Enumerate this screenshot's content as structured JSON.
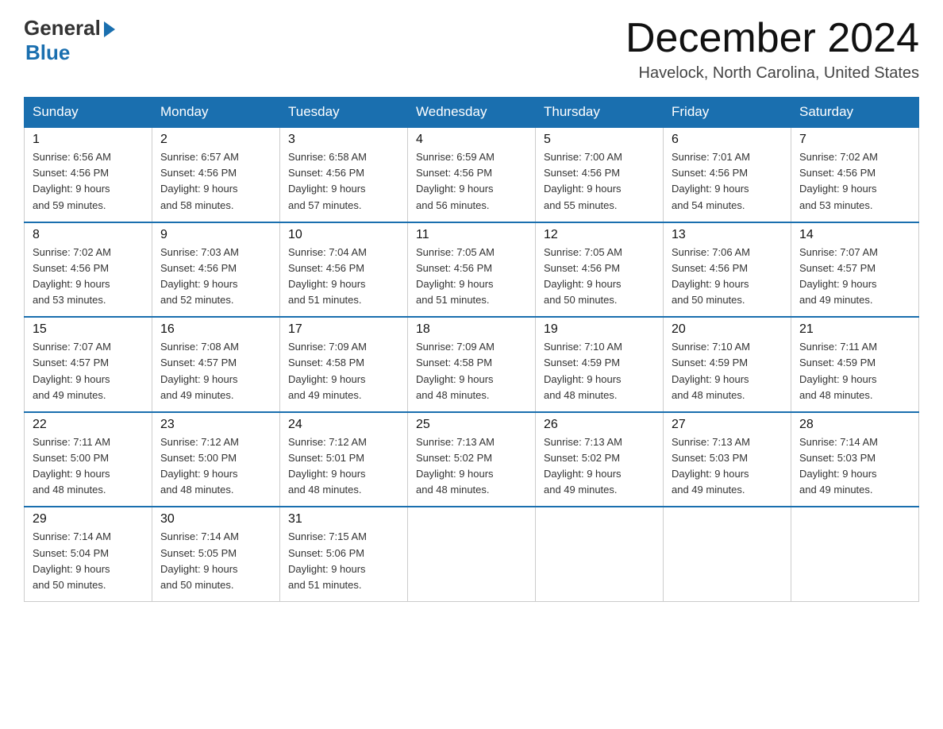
{
  "header": {
    "logo_general": "General",
    "logo_blue": "Blue",
    "logo_subtitle": "Blue",
    "month_title": "December 2024",
    "location": "Havelock, North Carolina, United States"
  },
  "days_of_week": [
    "Sunday",
    "Monday",
    "Tuesday",
    "Wednesday",
    "Thursday",
    "Friday",
    "Saturday"
  ],
  "weeks": [
    [
      {
        "day": "1",
        "info": "Sunrise: 6:56 AM\nSunset: 4:56 PM\nDaylight: 9 hours\nand 59 minutes."
      },
      {
        "day": "2",
        "info": "Sunrise: 6:57 AM\nSunset: 4:56 PM\nDaylight: 9 hours\nand 58 minutes."
      },
      {
        "day": "3",
        "info": "Sunrise: 6:58 AM\nSunset: 4:56 PM\nDaylight: 9 hours\nand 57 minutes."
      },
      {
        "day": "4",
        "info": "Sunrise: 6:59 AM\nSunset: 4:56 PM\nDaylight: 9 hours\nand 56 minutes."
      },
      {
        "day": "5",
        "info": "Sunrise: 7:00 AM\nSunset: 4:56 PM\nDaylight: 9 hours\nand 55 minutes."
      },
      {
        "day": "6",
        "info": "Sunrise: 7:01 AM\nSunset: 4:56 PM\nDaylight: 9 hours\nand 54 minutes."
      },
      {
        "day": "7",
        "info": "Sunrise: 7:02 AM\nSunset: 4:56 PM\nDaylight: 9 hours\nand 53 minutes."
      }
    ],
    [
      {
        "day": "8",
        "info": "Sunrise: 7:02 AM\nSunset: 4:56 PM\nDaylight: 9 hours\nand 53 minutes."
      },
      {
        "day": "9",
        "info": "Sunrise: 7:03 AM\nSunset: 4:56 PM\nDaylight: 9 hours\nand 52 minutes."
      },
      {
        "day": "10",
        "info": "Sunrise: 7:04 AM\nSunset: 4:56 PM\nDaylight: 9 hours\nand 51 minutes."
      },
      {
        "day": "11",
        "info": "Sunrise: 7:05 AM\nSunset: 4:56 PM\nDaylight: 9 hours\nand 51 minutes."
      },
      {
        "day": "12",
        "info": "Sunrise: 7:05 AM\nSunset: 4:56 PM\nDaylight: 9 hours\nand 50 minutes."
      },
      {
        "day": "13",
        "info": "Sunrise: 7:06 AM\nSunset: 4:56 PM\nDaylight: 9 hours\nand 50 minutes."
      },
      {
        "day": "14",
        "info": "Sunrise: 7:07 AM\nSunset: 4:57 PM\nDaylight: 9 hours\nand 49 minutes."
      }
    ],
    [
      {
        "day": "15",
        "info": "Sunrise: 7:07 AM\nSunset: 4:57 PM\nDaylight: 9 hours\nand 49 minutes."
      },
      {
        "day": "16",
        "info": "Sunrise: 7:08 AM\nSunset: 4:57 PM\nDaylight: 9 hours\nand 49 minutes."
      },
      {
        "day": "17",
        "info": "Sunrise: 7:09 AM\nSunset: 4:58 PM\nDaylight: 9 hours\nand 49 minutes."
      },
      {
        "day": "18",
        "info": "Sunrise: 7:09 AM\nSunset: 4:58 PM\nDaylight: 9 hours\nand 48 minutes."
      },
      {
        "day": "19",
        "info": "Sunrise: 7:10 AM\nSunset: 4:59 PM\nDaylight: 9 hours\nand 48 minutes."
      },
      {
        "day": "20",
        "info": "Sunrise: 7:10 AM\nSunset: 4:59 PM\nDaylight: 9 hours\nand 48 minutes."
      },
      {
        "day": "21",
        "info": "Sunrise: 7:11 AM\nSunset: 4:59 PM\nDaylight: 9 hours\nand 48 minutes."
      }
    ],
    [
      {
        "day": "22",
        "info": "Sunrise: 7:11 AM\nSunset: 5:00 PM\nDaylight: 9 hours\nand 48 minutes."
      },
      {
        "day": "23",
        "info": "Sunrise: 7:12 AM\nSunset: 5:00 PM\nDaylight: 9 hours\nand 48 minutes."
      },
      {
        "day": "24",
        "info": "Sunrise: 7:12 AM\nSunset: 5:01 PM\nDaylight: 9 hours\nand 48 minutes."
      },
      {
        "day": "25",
        "info": "Sunrise: 7:13 AM\nSunset: 5:02 PM\nDaylight: 9 hours\nand 48 minutes."
      },
      {
        "day": "26",
        "info": "Sunrise: 7:13 AM\nSunset: 5:02 PM\nDaylight: 9 hours\nand 49 minutes."
      },
      {
        "day": "27",
        "info": "Sunrise: 7:13 AM\nSunset: 5:03 PM\nDaylight: 9 hours\nand 49 minutes."
      },
      {
        "day": "28",
        "info": "Sunrise: 7:14 AM\nSunset: 5:03 PM\nDaylight: 9 hours\nand 49 minutes."
      }
    ],
    [
      {
        "day": "29",
        "info": "Sunrise: 7:14 AM\nSunset: 5:04 PM\nDaylight: 9 hours\nand 50 minutes."
      },
      {
        "day": "30",
        "info": "Sunrise: 7:14 AM\nSunset: 5:05 PM\nDaylight: 9 hours\nand 50 minutes."
      },
      {
        "day": "31",
        "info": "Sunrise: 7:15 AM\nSunset: 5:06 PM\nDaylight: 9 hours\nand 51 minutes."
      },
      null,
      null,
      null,
      null
    ]
  ]
}
